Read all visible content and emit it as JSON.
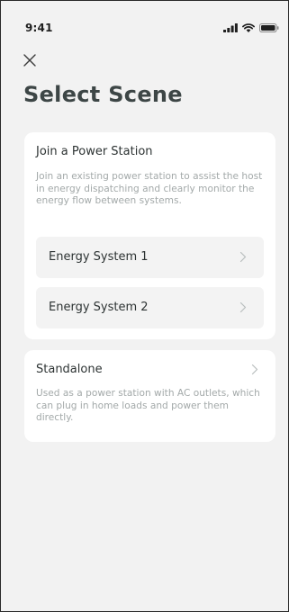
{
  "status_bar": {
    "time": "9:41",
    "icons": [
      "cellular-signal-icon",
      "wifi-icon",
      "battery-icon"
    ]
  },
  "header": {
    "close_icon": "close-icon",
    "title": "Select Scene"
  },
  "power_station": {
    "title": "Join a Power Station",
    "description": "Join an existing power station to assist the host in energy dispatching and clearly monitor the energy flow between systems.",
    "systems": [
      {
        "label": "Energy System 1"
      },
      {
        "label": "Energy System 2"
      }
    ]
  },
  "standalone": {
    "title": "Standalone",
    "description": "Used as a power station with AC outlets, which can plug in home loads and power them directly."
  },
  "colors": {
    "background": "#f2f2f2",
    "card": "#ffffff",
    "row": "#f3f3f3",
    "title_text": "#3d4646",
    "body_text": "#2d3333",
    "muted_text": "#a3a9a9"
  }
}
